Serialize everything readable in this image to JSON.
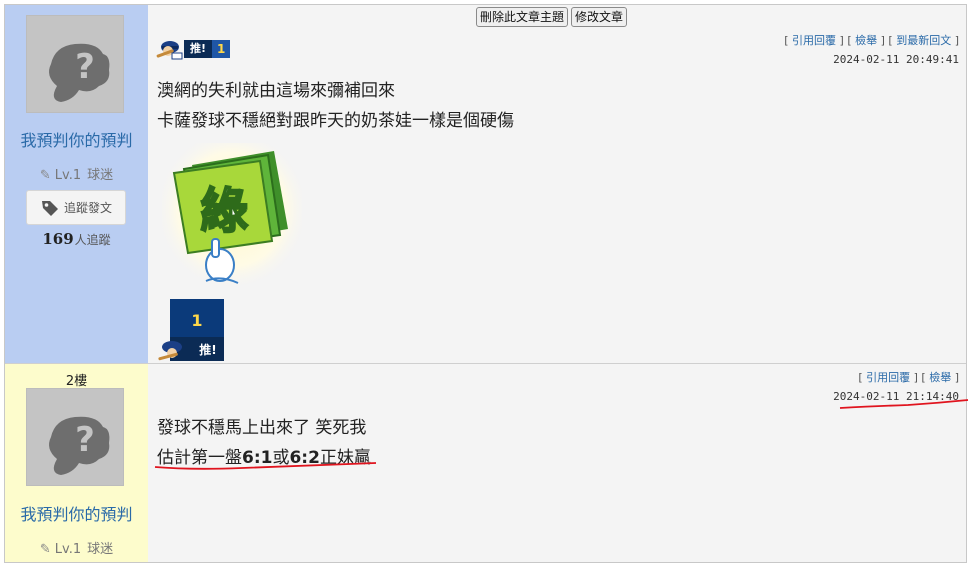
{
  "post1": {
    "user": {
      "name": "我預判你的預判",
      "level": "Lv.1",
      "title": "球迷"
    },
    "follow_button": "追蹤發文",
    "followers": {
      "count": "169",
      "suffix": "人追蹤"
    },
    "buttons": {
      "delete_topic": "刪除此文章主題",
      "edit_post": "修改文章"
    },
    "links": {
      "quote": "引用回覆",
      "report": "檢舉",
      "latest": "到最新回文"
    },
    "timestamp": "2024-02-11 20:49:41",
    "push": {
      "label": "推!",
      "count": "1"
    },
    "content": {
      "line1": "澳網的失利就由這場來彌補回來",
      "line2": "卡薩發球不穩絕對跟昨天的奶茶娃一樣是個硬傷"
    },
    "sticker_text": "綠",
    "push_badge": {
      "count": "1",
      "label": "推!"
    }
  },
  "post2": {
    "floor": "2樓",
    "user": {
      "name": "我預判你的預判",
      "level": "Lv.1",
      "title": "球迷"
    },
    "links": {
      "quote": "引用回覆",
      "report": "檢舉"
    },
    "timestamp": "2024-02-11 21:14:40",
    "content": {
      "line1": "發球不穩馬上出來了 笑死我",
      "line2_a": "估計第一盤",
      "line2_b": "6:1",
      "line2_c": "或",
      "line2_d": "6:2",
      "line2_e": "正妹贏"
    }
  },
  "colors": {
    "sidebar1": "#b9cdf2",
    "sidebar2": "#fdfccc",
    "link": "#2a6aa8",
    "annotation": "#e0141e"
  }
}
